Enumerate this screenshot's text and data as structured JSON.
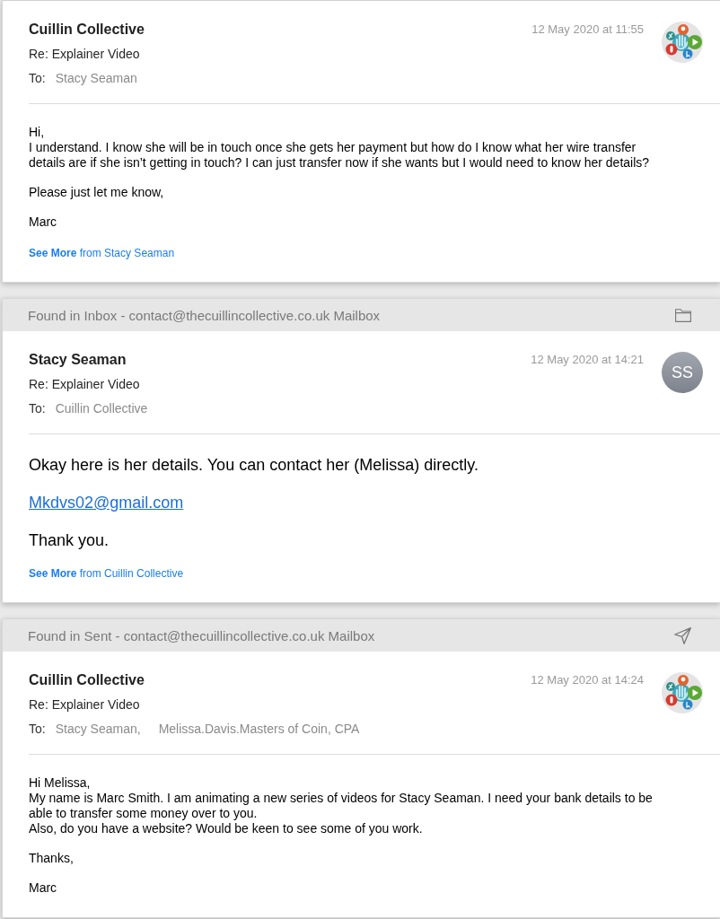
{
  "messages": [
    {
      "kind": "standard",
      "sender": "Cuillin Collective",
      "date": "12 May 2020 at 11:55",
      "avatar": {
        "kind": "logo"
      },
      "subject": "Re: Explainer Video",
      "to_label": "To:",
      "to": [
        "Stacy Seaman"
      ],
      "body": [
        {
          "kind": "text",
          "text": "Hi,\nI understand. I know she will be in touch once she gets her payment but how do I know what her wire transfer details are if she isn’t getting in touch? I can just transfer now if she wants but I would need to know her details?"
        },
        {
          "kind": "text",
          "text": "Please just let me know,"
        },
        {
          "kind": "text",
          "text": "Marc"
        }
      ],
      "see_more": "**See More** from Stacy Seaman"
    },
    {
      "kind": "large",
      "found_in": {
        "kind": "folder",
        "text": "Found in Inbox - contact@thecuillincollective.co.uk Mailbox"
      },
      "sender": "Stacy Seaman",
      "date": "12 May 2020 at 14:21",
      "avatar": {
        "kind": "initials",
        "text": "SS"
      },
      "subject": "Re: Explainer Video",
      "to_label": "To:",
      "to": [
        "Cuillin Collective"
      ],
      "body": [
        {
          "kind": "text",
          "text": "Okay here is her details. You can contact her (Melissa) directly."
        },
        {
          "kind": "link",
          "text": "Mkdvs02@gmail.com"
        },
        {
          "kind": "text",
          "text": "Thank you."
        }
      ],
      "see_more": "**See More** from Cuillin Collective"
    },
    {
      "kind": "standard",
      "found_in": {
        "kind": "sent",
        "text": "Found in Sent - contact@thecuillincollective.co.uk Mailbox"
      },
      "sender": "Cuillin Collective",
      "date": "12 May 2020 at 14:24",
      "avatar": {
        "kind": "logo"
      },
      "subject": "Re: Explainer Video",
      "to_label": "To:",
      "to": [
        "Stacy Seaman,",
        "Melissa.Davis.Masters of Coin, CPA"
      ],
      "body": [
        {
          "kind": "text",
          "text": "Hi Melissa,\nMy name is Marc Smith. I am animating a new series of videos for Stacy Seaman. I need your bank details to be able to transfer some money over to you.\nAlso, do you have a website? Would be keen to see some of you work."
        },
        {
          "kind": "text",
          "text": "Thanks,"
        },
        {
          "kind": "text",
          "text": "Marc"
        }
      ]
    }
  ]
}
